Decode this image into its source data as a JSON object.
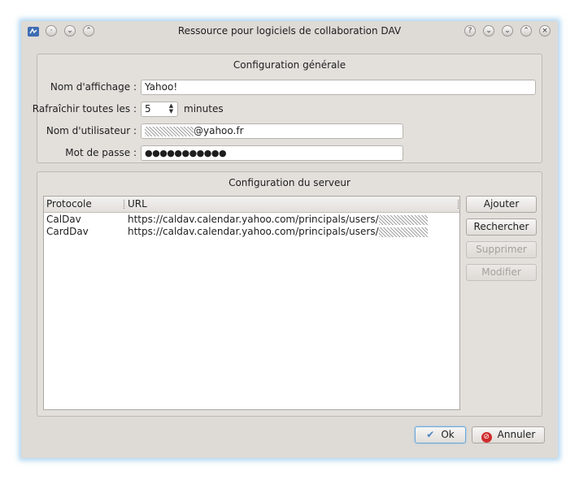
{
  "window": {
    "title": "Ressource pour logiciels de collaboration DAV",
    "titlebar_left_buttons": [
      "menu-dot",
      "minimize-chevron",
      "maximize-chevron"
    ],
    "titlebar_right_buttons": [
      "help",
      "shade",
      "minimize",
      "maximize",
      "close"
    ]
  },
  "general": {
    "title": "Configuration générale",
    "display_name_label": "Nom d'affichage :",
    "display_name_value": "Yahoo!",
    "refresh_label": "Rafraîchir toutes les :",
    "refresh_value": "5",
    "refresh_unit": "minutes",
    "username_label": "Nom d'utilisateur :",
    "username_suffix": "@yahoo.fr",
    "password_label": "Mot de passe :",
    "password_mask": "●●●●●●●●●●●"
  },
  "server": {
    "title": "Configuration du serveur",
    "columns": [
      "Protocole",
      "URL"
    ],
    "rows": [
      {
        "protocol": "CalDav",
        "url": "https://caldav.calendar.yahoo.com/principals/users/"
      },
      {
        "protocol": "CardDav",
        "url": "https://caldav.calendar.yahoo.com/principals/users/"
      }
    ],
    "buttons": {
      "add": "Ajouter",
      "search": "Rechercher",
      "delete": "Supprimer",
      "modify": "Modifier"
    }
  },
  "footer": {
    "ok": "Ok",
    "cancel": "Annuler"
  },
  "colors": {
    "window_bg": "#dedad6",
    "focus_glow": "#6eb4e6",
    "cancel_icon": "#d02b2b"
  }
}
